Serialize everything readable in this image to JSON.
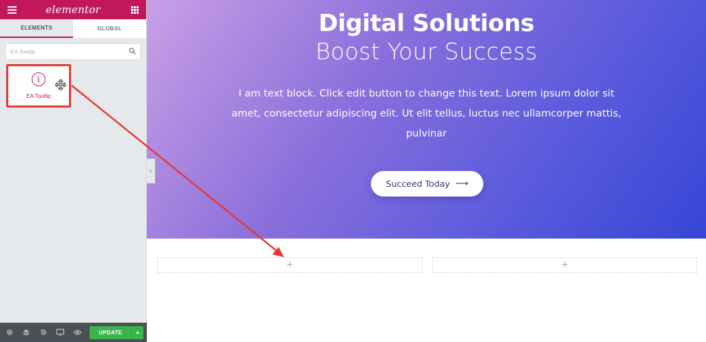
{
  "sidebar": {
    "brand": "elementor",
    "tabs": [
      {
        "label": "ELEMENTS"
      },
      {
        "label": "GLOBAL"
      }
    ],
    "search": {
      "value": "",
      "placeholder": "EA Tooltip"
    },
    "widget": {
      "label": "EA Tooltip",
      "icon": "info-circle-icon"
    },
    "footer": {
      "icons": [
        "gear-icon",
        "layers-icon",
        "history-icon",
        "responsive-icon",
        "eye-icon"
      ],
      "update_label": "UPDATE"
    }
  },
  "hero": {
    "title": "Digital Solutions",
    "subtitle": "Boost Your Success",
    "text": "I am text block. Click edit button to change this text. Lorem ipsum dolor sit amet, consectetur adipiscing elit. Ut elit tellus, luctus nec ullamcorper mattis, pulvinar",
    "cta_label": "Succeed Today"
  },
  "drop_zone": {
    "columns": [
      {
        "symbol": "+"
      },
      {
        "symbol": "+"
      }
    ]
  },
  "colors": {
    "brand": "#c2185b",
    "annotation": "#e53935",
    "update": "#39b54a",
    "hero_start": "#c9a0e6",
    "hero_end": "#3646d6"
  }
}
